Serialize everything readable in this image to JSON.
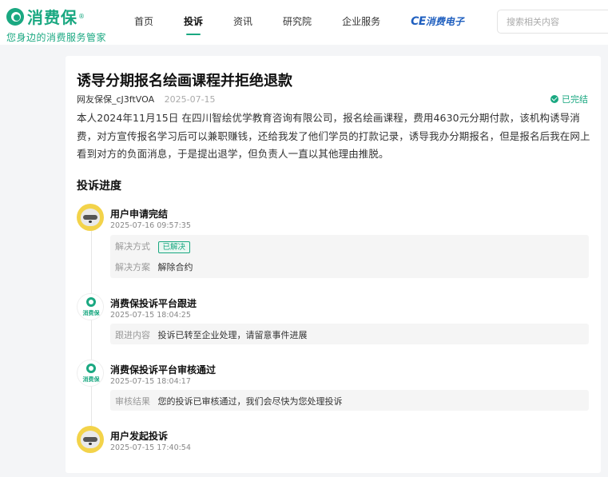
{
  "header": {
    "logo_text": "消费保",
    "logo_reg": "®",
    "slogan": "您身边的消费服务管家",
    "nav": [
      {
        "label": "首页"
      },
      {
        "label": "投诉"
      },
      {
        "label": "资讯"
      },
      {
        "label": "研究院"
      },
      {
        "label": "企业服务"
      }
    ],
    "brand_ce": "CE",
    "brand_text": "消费电子",
    "search_placeholder": "搜索相关内容"
  },
  "complaint": {
    "title": "诱导分期报名绘画课程并拒绝退款",
    "author": "网友保保_cJ3ftVOA",
    "date": "2025-07-15",
    "status": "已完结",
    "description": "本人2024年11月15日 在四川智绘优学教育咨询有限公司，报名绘画课程，费用4630元分期付款，该机构诱导消费，对方宣传报名学习后可以兼职赚钱，还给我发了他们学员的打款记录，诱导我办分期报名，但是报名后我在网上看到对方的负面消息，于是提出退学，但负责人一直以其他理由推脱。"
  },
  "progress": {
    "section_title": "投诉进度",
    "nodes": [
      {
        "title": "用户申请完结",
        "time": "2025-07-16 09:57:35",
        "row1_label": "解决方式",
        "row1_badge": "已解决",
        "row2_label": "解决方案",
        "row2_value": "解除合约"
      },
      {
        "title": "消费保投诉平台跟进",
        "time": "2025-07-15 18:04:25",
        "label": "跟进内容",
        "value": "投诉已转至企业处理，请留意事件进展"
      },
      {
        "title": "消费保投诉平台审核通过",
        "time": "2025-07-15 18:04:17",
        "label": "审核结果",
        "value": "您的投诉已审核通过，我们会尽快为您处理投诉"
      },
      {
        "title": "用户发起投诉",
        "time": "2025-07-15 17:40:54"
      }
    ],
    "platform_avatar_text": "消费保"
  }
}
